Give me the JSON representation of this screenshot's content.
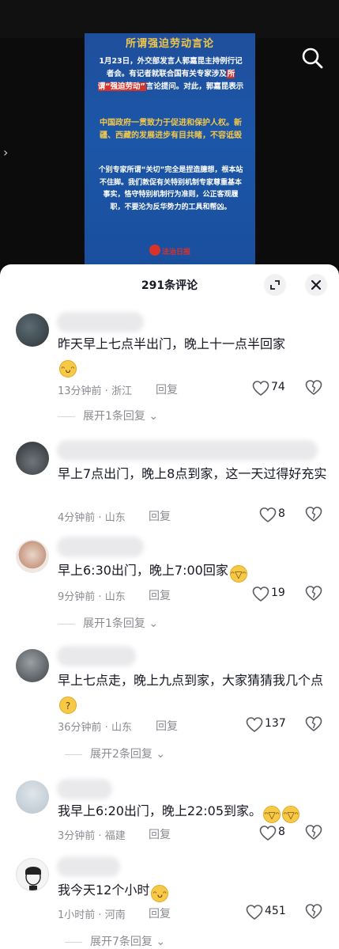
{
  "video": {
    "poster_title": "所谓强迫劳动言论",
    "poster_p1_a": "1月23日，外交部发言人郭嘉昆主持例行记者会。有记者就联合国有关专家涉及",
    "poster_p1_hl": "所谓“强迫劳动”",
    "poster_p1_b": "言论提问。对此，郭嘉昆表示",
    "poster_p2": "中国政府一贯致力于促进和保护人权。新疆、西藏的发展进步有目共睹，不容诋毁",
    "poster_p3": "个别专家所谓“关切”完全是捏造臆想，根本站不住脚。我们敦促有关特别机制专家尊重基本事实，恪守特别机制行为准则，公正客观履职，不要沦为反华势力的工具和帮凶。",
    "poster_logo": "法治日报"
  },
  "sheet": {
    "title": "291条评论"
  },
  "comments": [
    {
      "text": "昨天早上七点半出门，晚上十一点半回家",
      "emoji": "😁",
      "time": "13分钟前",
      "region": "浙江",
      "reply": "回复",
      "likes": "74",
      "expand": "展开1条回复"
    },
    {
      "text": "早上7点出门，晚上8点到家，这一天过得好充实",
      "time": "4分钟前",
      "region": "山东",
      "reply": "回复",
      "likes": "8"
    },
    {
      "text": "早上6:30出门，晚上7:00回家",
      "emoji": "🤣",
      "time": "9分钟前",
      "region": "山东",
      "reply": "回复",
      "likes": "19",
      "expand": "展开1条回复"
    },
    {
      "text": "早上七点走，晚上九点到家，大家猜猜我几个点",
      "emoji": "🤔",
      "time": "36分钟前",
      "region": "山东",
      "reply": "回复",
      "likes": "137",
      "expand": "展开2条回复"
    },
    {
      "text": "我早上6:20出门，晚上22:05到家。",
      "emoji": "🤣🤣",
      "time": "3分钟前",
      "region": "福建",
      "reply": "回复",
      "likes": "8"
    },
    {
      "text": "我今天12个小时",
      "emoji": "😁",
      "time": "1小时前",
      "region": "河南",
      "reply": "回复",
      "likes": "451",
      "expand": "展开7条回复"
    }
  ],
  "colors": {
    "accent": "#161823",
    "meta": "#8a8b91",
    "poster_blue": "#1c56a8",
    "poster_gold": "#f2c84b"
  }
}
